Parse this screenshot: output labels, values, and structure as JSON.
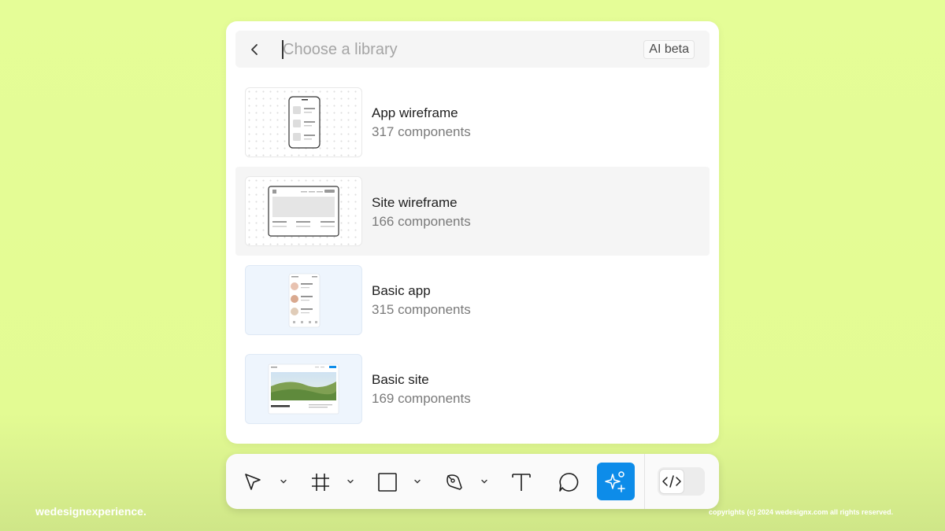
{
  "search": {
    "placeholder": "Choose a library",
    "badge": "AI beta"
  },
  "libraries": [
    {
      "name": "App wireframe",
      "count": "317 components",
      "thumbnail": "app-wireframe"
    },
    {
      "name": "Site wireframe",
      "count": "166 components",
      "thumbnail": "site-wireframe"
    },
    {
      "name": "Basic app",
      "count": "315 components",
      "thumbnail": "basic-app"
    },
    {
      "name": "Basic site",
      "count": "169 components",
      "thumbnail": "basic-site"
    }
  ],
  "toolbar": {
    "tools": [
      "move-icon",
      "frame-icon",
      "rectangle-icon",
      "pen-icon",
      "text-icon",
      "comment-icon",
      "ai-sparkle-icon",
      "code-icon"
    ],
    "accent": "#0d8ce9"
  },
  "footer": {
    "brand": "wedesignexperience.",
    "copyright": "copyrights (c) 2024 wedesignx.com all rights reserved."
  },
  "colors": {
    "background": "#e5fd97",
    "panel": "#ffffff",
    "hover_row": "#f5f5f5"
  }
}
